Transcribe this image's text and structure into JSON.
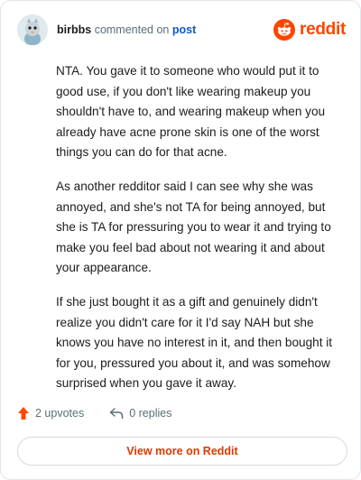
{
  "comment": {
    "author": "birbbs",
    "action_text": "commented on",
    "post_link": "post",
    "paragraphs": [
      "NTA. You gave it to someone who would put it to good use, if you don't like wearing makeup you shouldn't have to, and wearing makeup when you already have acne prone skin is one of the worst things you can do for that acne.",
      "As another redditor said I can see why she was annoyed, and she's not TA for being annoyed, but she is TA for pressuring you to wear it and trying to make you feel bad about not wearing it and about your appearance.",
      "If she just bought it as a gift and genuinely didn't realize you didn't care for it I'd say NAH but she knows you have no interest in it, and then bought it for you, pressured you about it, and was somehow surprised when you gave it away."
    ]
  },
  "brand": {
    "name": "reddit",
    "color": "#ff4500",
    "icon": "reddit-logo-icon"
  },
  "actions": {
    "upvotes": "2 upvotes",
    "replies": "0 replies",
    "upvote_icon": "upvote-arrow-icon",
    "reply_icon": "reply-arrow-icon"
  },
  "footer": {
    "view_more": "View more on Reddit"
  },
  "colors": {
    "accent": "#ff4500",
    "link": "#0a59c9",
    "muted": "#576f76",
    "button_text": "#d93a00"
  }
}
